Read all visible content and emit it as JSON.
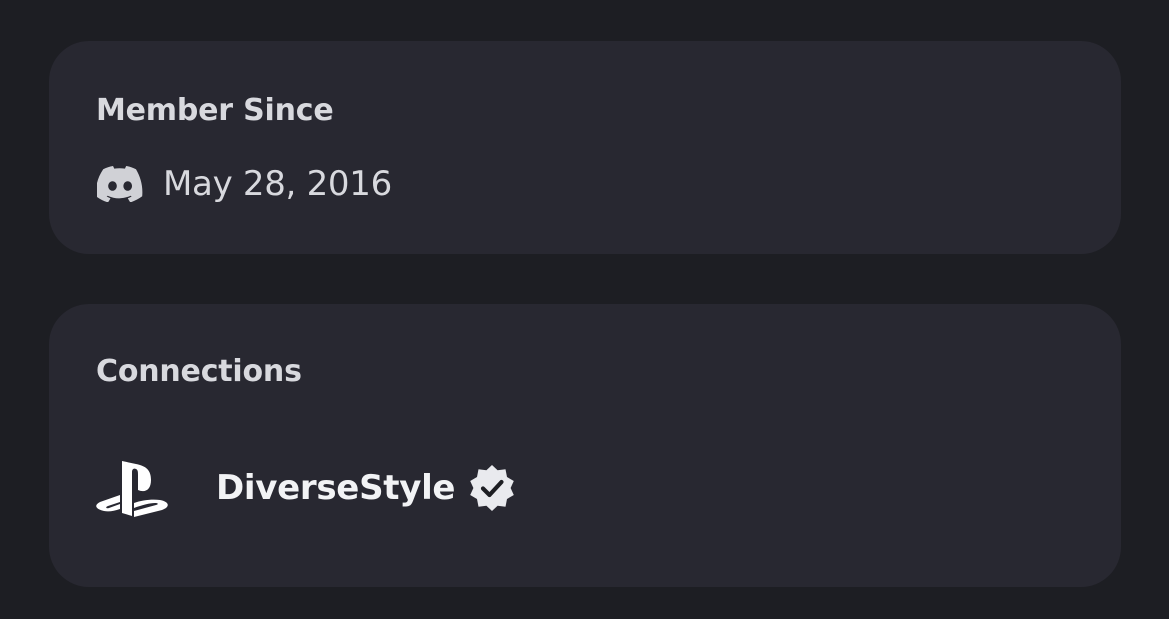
{
  "member_since": {
    "title": "Member Since",
    "icon": "discord-icon",
    "date": "May 28, 2016"
  },
  "connections": {
    "title": "Connections",
    "items": [
      {
        "platform_icon": "playstation-icon",
        "username": "DiverseStyle",
        "verified": true,
        "badge_icon": "verified-badge-icon"
      }
    ]
  },
  "colors": {
    "page_background": "#1d1e23",
    "card_background": "#282831",
    "heading_text": "#d8d9de",
    "username_text": "#f2f3f5",
    "icon_fill": "#ffffff"
  }
}
